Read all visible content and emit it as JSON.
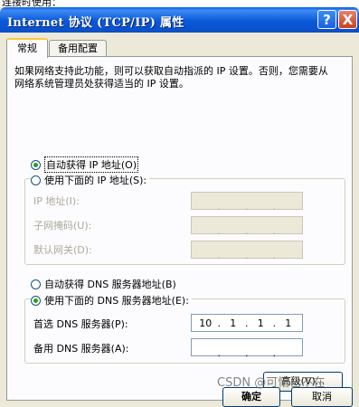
{
  "background_text": "连接时使用：",
  "window": {
    "title": "Internet 协议 (TCP/IP) 属性",
    "help_icon": "?",
    "close_icon": "X"
  },
  "tabs": [
    {
      "label": "常规",
      "active": true
    },
    {
      "label": "备用配置",
      "active": false
    }
  ],
  "description": "如果网络支持此功能，则可以获取自动指派的 IP 设置。否则，您需要从网络系统管理员处获得适当的 IP 设置。",
  "ip_section": {
    "auto_label": "自动获得 IP 地址(O)",
    "auto_selected": true,
    "manual_label": "使用下面的 IP 地址(S):",
    "manual_selected": false,
    "fields": [
      {
        "label": "IP 地址(I):",
        "octets": [
          "",
          "",
          "",
          ""
        ],
        "enabled": false
      },
      {
        "label": "子网掩码(U):",
        "octets": [
          "",
          "",
          "",
          ""
        ],
        "enabled": false
      },
      {
        "label": "默认网关(D):",
        "octets": [
          "",
          "",
          "",
          ""
        ],
        "enabled": false
      }
    ]
  },
  "dns_section": {
    "auto_label": "自动获得 DNS 服务器地址(B)",
    "auto_selected": false,
    "manual_label": "使用下面的 DNS 服务器地址(E):",
    "manual_selected": true,
    "fields": [
      {
        "label": "首选 DNS 服务器(P):",
        "octets": [
          "10",
          "1",
          "1",
          "1"
        ],
        "enabled": true
      },
      {
        "label": "备用 DNS 服务器(A):",
        "octets": [
          "",
          "",
          "",
          ""
        ],
        "enabled": true
      }
    ]
  },
  "buttons": {
    "advanced": "高级(V)...",
    "ok": "确定",
    "cancel": "取消"
  },
  "watermark": "CSDN @可惜已不在"
}
